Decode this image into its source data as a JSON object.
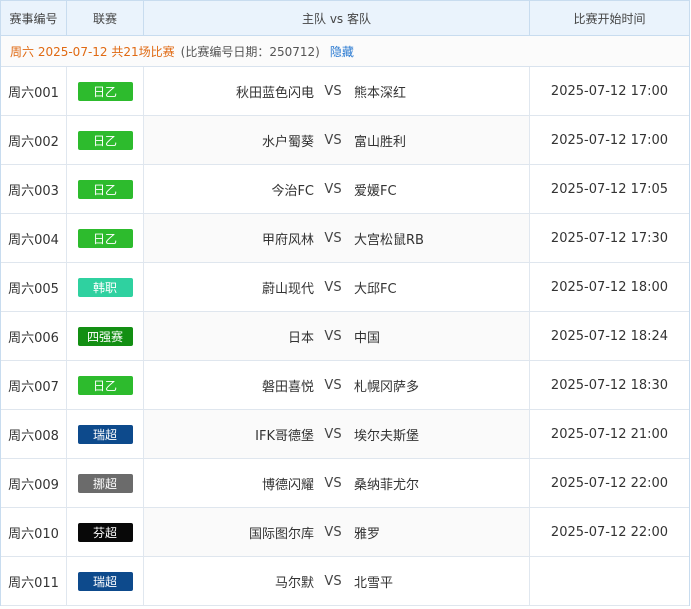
{
  "header": {
    "col_id": "赛事编号",
    "col_league": "联赛",
    "col_match": "主队 vs 客队",
    "col_time": "比赛开始时间"
  },
  "info": {
    "date_label": "周六 2025-07-12 共21场比赛",
    "meta_label": "(比赛编号日期：250712)",
    "hide_label": "隐藏"
  },
  "vs_label": "VS",
  "matches": [
    {
      "id": "周六001",
      "league": "日乙",
      "league_color": "#2dbb2d",
      "home": "秋田蓝色闪电",
      "away": "熊本深红",
      "time": "2025-07-12 17:00"
    },
    {
      "id": "周六002",
      "league": "日乙",
      "league_color": "#2dbb2d",
      "home": "水户蜀葵",
      "away": "富山胜利",
      "time": "2025-07-12 17:00"
    },
    {
      "id": "周六003",
      "league": "日乙",
      "league_color": "#2dbb2d",
      "home": "今治FC",
      "away": "爱媛FC",
      "time": "2025-07-12 17:05"
    },
    {
      "id": "周六004",
      "league": "日乙",
      "league_color": "#2dbb2d",
      "home": "甲府风林",
      "away": "大宫松鼠RB",
      "time": "2025-07-12 17:30"
    },
    {
      "id": "周六005",
      "league": "韩职",
      "league_color": "#2fd1a0",
      "home": "蔚山现代",
      "away": "大邱FC",
      "time": "2025-07-12 18:00"
    },
    {
      "id": "周六006",
      "league": "四强赛",
      "league_color": "#138f13",
      "home": "日本",
      "away": "中国",
      "time": "2025-07-12 18:24"
    },
    {
      "id": "周六007",
      "league": "日乙",
      "league_color": "#2dbb2d",
      "home": "磐田喜悦",
      "away": "札幌冈萨多",
      "time": "2025-07-12 18:30"
    },
    {
      "id": "周六008",
      "league": "瑞超",
      "league_color": "#0d4a8c",
      "home": "IFK哥德堡",
      "away": "埃尔夫斯堡",
      "time": "2025-07-12 21:00"
    },
    {
      "id": "周六009",
      "league": "挪超",
      "league_color": "#6b6b6b",
      "home": "博德闪耀",
      "away": "桑纳菲尤尔",
      "time": "2025-07-12 22:00"
    },
    {
      "id": "周六010",
      "league": "芬超",
      "league_color": "#080808",
      "home": "国际图尔库",
      "away": "雅罗",
      "time": "2025-07-12 22:00"
    },
    {
      "id": "周六011",
      "league": "瑞超",
      "league_color": "#0d4a8c",
      "home": "马尔默",
      "away": "北雪平",
      "time": ""
    }
  ]
}
